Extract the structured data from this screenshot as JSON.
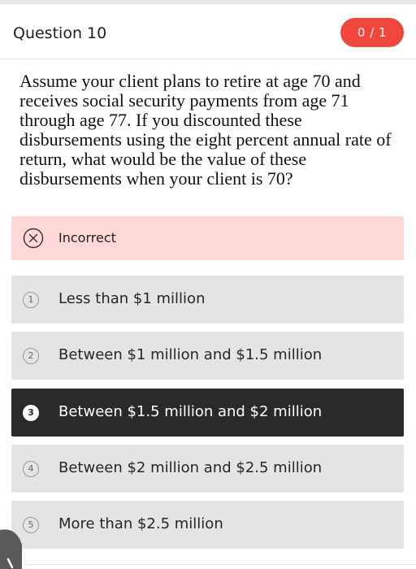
{
  "header": {
    "question_title": "Question 10",
    "score": "0 / 1"
  },
  "question": {
    "text": "Assume your client plans to retire at age 70 and receives social security payments from age 71 through age 77. If you discounted these disbursements using the eight percent annual rate of return, what would be the value of these disbursements when your client is 70?"
  },
  "result": {
    "label": "Incorrect",
    "icon": "x-circle-icon"
  },
  "options": [
    {
      "number": "1",
      "label": "Less than $1 million",
      "selected": false
    },
    {
      "number": "2",
      "label": "Between $1 million and $1.5 million",
      "selected": false
    },
    {
      "number": "3",
      "label": "Between $1.5 million and $2 million",
      "selected": true
    },
    {
      "number": "4",
      "label": "Between $2 million and $2.5 million",
      "selected": false
    },
    {
      "number": "5",
      "label": "More than $2.5 million",
      "selected": false
    }
  ],
  "colors": {
    "score_badge": "#f0463c",
    "incorrect_background": "#fdd8d7",
    "option_background": "#e4e4e4",
    "selected_option_background": "#2a2a2a"
  }
}
